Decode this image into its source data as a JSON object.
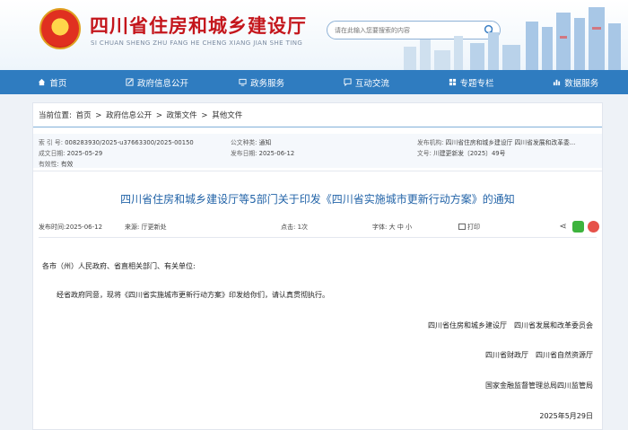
{
  "header": {
    "title": "四川省住房和城乡建设厅",
    "pinyin": "SI CHUAN SHENG ZHU FANG HE CHENG XIANG JIAN SHE TING",
    "search_placeholder": "请在此输入您要搜索的内容"
  },
  "nav": [
    {
      "label": "首页",
      "icon": "home-icon"
    },
    {
      "label": "政府信息公开",
      "icon": "edit-icon"
    },
    {
      "label": "政务服务",
      "icon": "monitor-icon"
    },
    {
      "label": "互动交流",
      "icon": "chat-icon"
    },
    {
      "label": "专题专栏",
      "icon": "grid-icon"
    },
    {
      "label": "数据服务",
      "icon": "chart-icon"
    }
  ],
  "breadcrumb": {
    "prefix": "当前位置:",
    "items": [
      "首页",
      "政府信息公开",
      "政策文件",
      "其他文件"
    ],
    "sep": ">"
  },
  "meta": {
    "index_label": "索 引 号:",
    "index_value": "008283930/2025-u37663300/2025-00150",
    "category_label": "公文种类:",
    "category_value": "通知",
    "issuer_label": "发布机构:",
    "issuer_value": "四川省住房和城乡建设厅 四川省发展和改革委...",
    "created_label": "成文日期:",
    "created_value": "2025-05-29",
    "published_label": "发布日期:",
    "published_value": "2025-06-12",
    "docno_label": "文号:",
    "docno_value": "川建更新发〔2025〕49号",
    "validity_label": "有效性:",
    "validity_value": "有效"
  },
  "article": {
    "title": "四川省住房和城乡建设厅等5部门关于印发《四川省实施城市更新行动方案》的通知",
    "time_label": "发布时间:",
    "time_value": "2025-06-12",
    "source_label": "来源:",
    "source_value": "厅更新处",
    "clicks_label": "点击:",
    "clicks_value": "1次",
    "font_label": "字体:",
    "font_sizes": [
      "大",
      "中",
      "小"
    ],
    "print_label": "打印",
    "greeting": "各市（州）人民政府、省直相关部门、有关单位:",
    "paragraph": "经省政府同意，现将《四川省实施城市更新行动方案》印发给你们，请认真贯彻执行。",
    "signatures": [
      "四川省住房和城乡建设厅　四川省发展和改革委员会",
      "四川省财政厅　四川省自然资源厅",
      "国家金融监督管理总局四川监管局"
    ],
    "date": "2025年5月29日"
  },
  "colors": {
    "brand_red": "#c4161c",
    "nav_blue": "#2f7cc0",
    "title_blue": "#2364a8"
  }
}
